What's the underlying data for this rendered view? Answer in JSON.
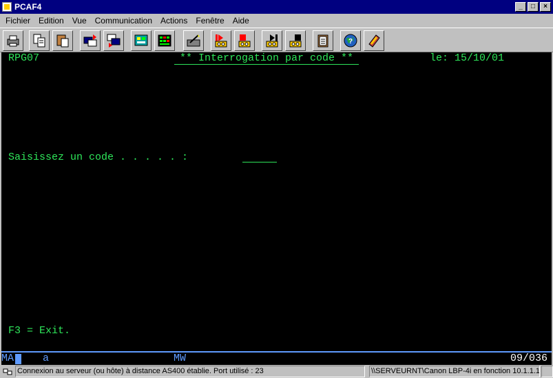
{
  "window": {
    "title": "PCAF4",
    "minimize": "_",
    "maximize": "□",
    "close": "×"
  },
  "menu": [
    "Fichier",
    "Edition",
    "Vue",
    "Communication",
    "Actions",
    "Fenêtre",
    "Aide"
  ],
  "toolbar_icons": [
    "print-icon",
    "copy-icon",
    "paste-icon",
    "send-icon",
    "receive-icon",
    "display-icon",
    "keypad-icon",
    "macro-edit-icon",
    "record-icon",
    "stop-icon",
    "play-icon",
    "pause-icon",
    "clipboard-icon",
    "globe-help-icon",
    "book-icon"
  ],
  "terminal": {
    "program": "RPG07",
    "title": "** Interrogation par code **",
    "date": "le: 15/10/01",
    "prompt": "Saisissez un code . . . . . :",
    "f3": "F3 = Exit."
  },
  "oia": {
    "mode": "MA",
    "indicator": "a",
    "workstation": "MW",
    "cursor_pos": "09/036"
  },
  "status": {
    "connection": "Connexion au serveur (ou hôte) à distance AS400 établie. Port utilisé : 23",
    "printer": "\\\\SERVEURNT\\Canon LBP-4i en fonction 10.1.1.1"
  },
  "colors": {
    "terminal_text": "#2ee65a",
    "oia_text": "#5f9bff",
    "titlebar": "#000080"
  }
}
